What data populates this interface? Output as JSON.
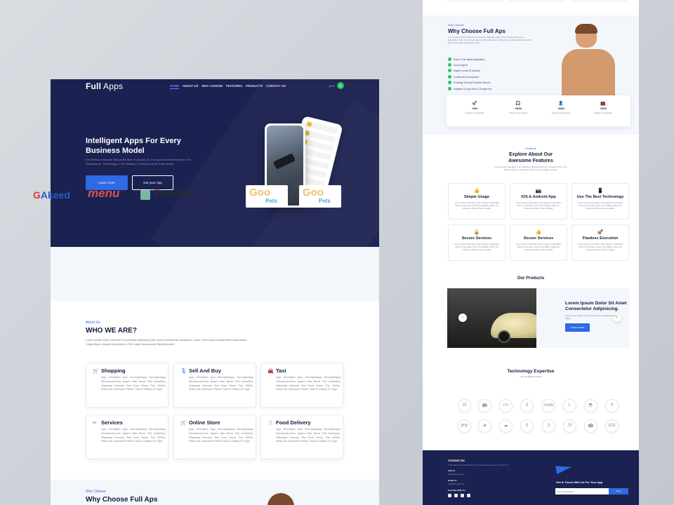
{
  "left": {
    "logo": {
      "bold": "Full",
      "light": " Apps"
    },
    "nav": [
      "HOME",
      "ABOUT US",
      "WHY CHOOSE",
      "FEATURES",
      "PRODUCTS",
      "CONTACT US"
    ],
    "lang_label": "عربي",
    "lang_icon": "ع",
    "hero": {
      "title": "Intelligent Apps For Every Business Model",
      "desc": "We Believe Everyone Should Be Able To Access To The Apps And Information In The Smartphone. Technology Is The Medium To Achieve More Daily Needs.",
      "btn_primary": "Learn more",
      "btn_secondary": "Get your App"
    },
    "brands": {
      "akeed_a": "G",
      "akeed_b": "Akeed",
      "menu": "menu",
      "prestige": "Prestige",
      "pets1_a": "Goo",
      "pets1_b": "Pets",
      "pets2_a": "Goo",
      "pets2_b": "Pets"
    },
    "about": {
      "tag": "About Us",
      "title": "WHO WE ARE?",
      "desc": "Lorem Ipsum Dolor Sit Amet Consectetur Adipisicing Elit. Autem Reiciendis Explicabo. Unde. Cum Quod Impedit Nihil Laboriosam Culpa Atque. Aliquid Modi Alias In Fill Culpa! Accusamus Reprehenderit."
    },
    "services": [
      {
        "title": "Shopping",
        "icon": "cart-icon",
        "glyph": "🛒",
        "desc": "App Devolped App Devolpedapp Devolpedapp DevolpedLorem Ipsum Has Been The Industry's Standard Dummy Text Ever Since The 1500s, When An Unknown Printer Took A Galley Of Type"
      },
      {
        "title": "Sell And Buy",
        "icon": "microphone-icon",
        "glyph": "🎙",
        "desc": "App Devolped App Devolpedapp Devolpedapp DevolpedLorem Ipsum Has Been The Industry's Standard Dummy Text Ever Since The 1500s, When An Unknown Printer Took A Galley Of Type"
      },
      {
        "title": "Taxi",
        "icon": "car-icon",
        "glyph": "🚘",
        "desc": "App Devolped App Devolpedapp Devolpedapp DevolpedLorem Ipsum Has Been The Industry's Standard Dummy Text Ever Since The 1500s, When An Unknown Printer Took A Galley Of Type"
      },
      {
        "title": "Services",
        "icon": "tools-icon",
        "glyph": "✂",
        "desc": "App Devolped App Devolpedapp Devolpedapp DevolpedLorem Ipsum Has Been The Industry's Standard Dummy Text Ever Since The 1500s, When An Unknown Printer Took A Galley Of Type"
      },
      {
        "title": "Online Store",
        "icon": "cart-icon",
        "glyph": "🛒",
        "desc": "App Devolped App Devolpedapp Devolpedapp DevolpedLorem Ipsum Has Been The Industry's Standard Dummy Text Ever Since The 1500s, When An Unknown Printer Took A Galley Of Type"
      },
      {
        "title": "Food Delivery",
        "icon": "utensils-icon",
        "glyph": "🍴",
        "desc": "App Devolped App Devolpedapp Devolpedapp DevolpedLorem Ipsum Has Been The Industry's Standard Dummy Text Ever Since The 1500s, When An Unknown Printer Took A Galley Of Type"
      }
    ],
    "why": {
      "tag": "Why Choose",
      "title": "Why Choose Full Aps"
    }
  },
  "right": {
    "why": {
      "tag": "Why Choose",
      "title": "Why Choose Full Aps",
      "desc": "Lorem Ipsum Dolor Sit Amet Consectetur Adipisicing Elit. Autem Reiciendis Lorem Explicabo. Unde Cum Quod Impedit Nihil Laboriosam Culpa Atque. Aliquid Modi Alias Will Rerum Accusamus Reprehenderit.",
      "checks": [
        "Easy To Use Mobile Application",
        "Good Support",
        "Highest Levels Of Security",
        "Continuous Development",
        "Providing The Most Powerful Servers",
        "Available On App Store & Google Play"
      ],
      "check_glyph": "✓"
    },
    "stats": [
      {
        "icon": "rocket-icon",
        "glyph": "🚀",
        "value": "+999",
        "label": "Projects Completed"
      },
      {
        "icon": "headset-icon",
        "glyph": "🎧",
        "value": "+9000",
        "label": "Projects Completed"
      },
      {
        "icon": "user-icon",
        "glyph": "👤",
        "value": "+3000",
        "label": "Projects Completed"
      },
      {
        "icon": "briefcase-icon",
        "glyph": "💼",
        "value": "+3000",
        "label": "Projects Completed"
      }
    ],
    "features": {
      "tag": "Features",
      "title": "Explore About Our Awesome Features",
      "desc": "Lorem Ipsum Has Been The Industry's Standard Dummy Text Ever Since The 1500s, When An Unknown Printer Took A Galley Of Type.",
      "items": [
        {
          "icon": "thumbs-up-icon",
          "glyph": "👍",
          "title": "Simple Usage",
          "desc": "Lorem Ipsum Has Been The Industry's Standard Dummy Text Ever Since The 1500s, When An Unknown Printer Took A Galley"
        },
        {
          "icon": "camera-icon",
          "glyph": "📷",
          "title": "IOS & Android App",
          "desc": "Lorem Ipsum Has Been The Industry's Standard Dummy Text Ever Since The 1500s, When An Unknown Printer Took A Galley"
        },
        {
          "icon": "mobile-icon",
          "glyph": "📱",
          "title": "Use The Best Technology",
          "desc": "Lorem Ipsum Has Been The Industry's Standard Dummy Text Ever Since The 1500s, When An Unknown Printer Took A Galley"
        },
        {
          "icon": "lock-icon",
          "glyph": "🔒",
          "title": "Secure Services",
          "desc": "Lorem Ipsum Has Been The Industry's Standard Dummy Text Ever Since The 1500s, When An Unknown Printer Took A Galley"
        },
        {
          "icon": "thumbs-up-icon",
          "glyph": "👍",
          "title": "Secure Services",
          "desc": "Lorem Ipsum Has Been The Industry's Standard Dummy Text Ever Since The 1500s, When An Unknown Printer Took A Galley"
        },
        {
          "icon": "rocket-icon",
          "glyph": "🚀",
          "title": "Flawless Execution",
          "desc": "Lorem Ipsum Has Been The Industry's Standard Dummy Text Ever Since The 1500s, When An Unknown Printer Took A Galley"
        }
      ]
    },
    "products": {
      "title": "Our Products",
      "item_title": "Lorem Ipsum Dolor Sit Amet Consectetur Adipisicing.",
      "item_desc": "Lorem Ipsum Dolor Sit Amet Consectetur Adipisicing Elit Magni",
      "btn": "LEARN MORE",
      "prev": "‹",
      "next": "›"
    },
    "tech": {
      "title": "Technology Expertise",
      "sub": "Our capabilities include",
      "row1": [
        {
          "icon": "js-icon",
          "glyph": "JS"
        },
        {
          "icon": "android-icon",
          "glyph": "🤖"
        },
        {
          "icon": "html-icon",
          "glyph": "</>"
        },
        {
          "icon": "css3-icon",
          "glyph": "3"
        },
        {
          "icon": "node-icon",
          "glyph": "node"
        },
        {
          "icon": "laravel-icon",
          "glyph": "L"
        },
        {
          "icon": "java-icon",
          "glyph": "☕"
        },
        {
          "icon": "swift-icon",
          "glyph": "S"
        }
      ],
      "row2": [
        {
          "icon": "php-icon",
          "glyph": "php"
        },
        {
          "icon": "ionic-icon",
          "glyph": "◈"
        },
        {
          "icon": "cloud-icon",
          "glyph": "☁"
        },
        {
          "icon": "html5-icon",
          "glyph": "5"
        },
        {
          "icon": "css-icon",
          "glyph": "3"
        },
        {
          "icon": "js-icon",
          "glyph": "JS"
        },
        {
          "icon": "android-icon",
          "glyph": "🤖"
        },
        {
          "icon": "ios-icon",
          "glyph": "iOS"
        }
      ]
    },
    "footer": {
      "title": "Contact Us",
      "desc": "If You Would Like To Discuss Your Questions Feel Free To Contact Us",
      "call_label": "Call Us",
      "call_value": "info@full-apps.com",
      "email_label": "Email Us",
      "email_value": "info@full-apps.com",
      "follow_label": "Socialize With Us",
      "touch": "Get In Touch With Us For Your App",
      "placeholder": "Enter email address",
      "send": "Send"
    }
  }
}
